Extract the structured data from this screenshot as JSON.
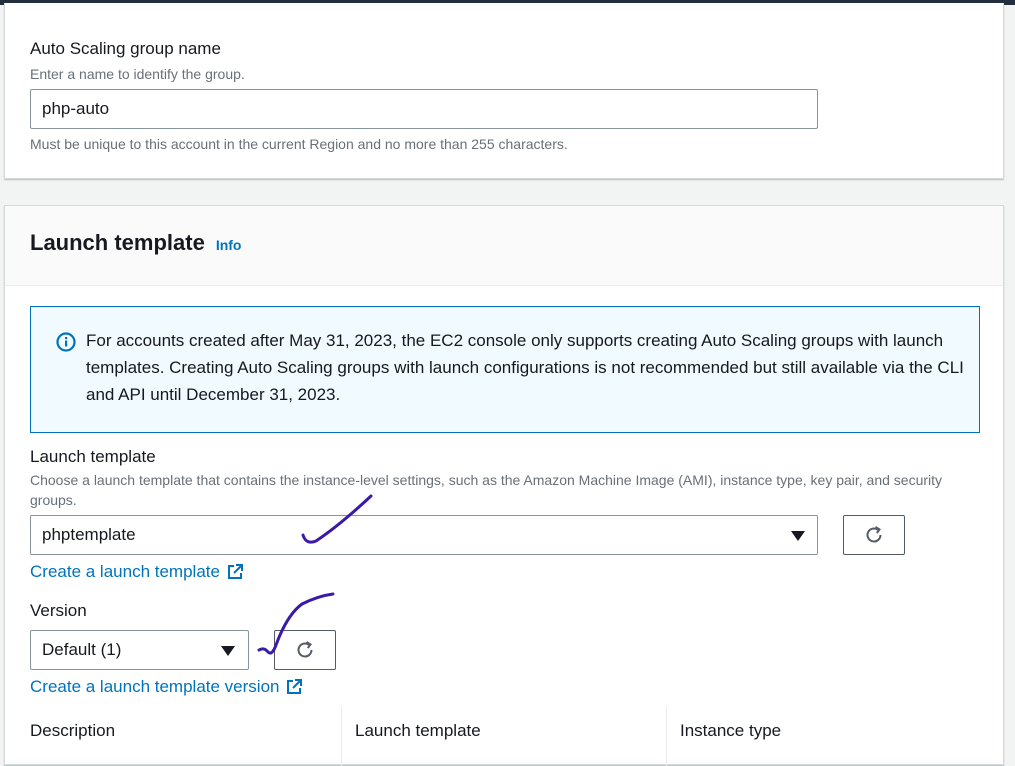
{
  "group_name": {
    "label": "Auto Scaling group name",
    "description": "Enter a name to identify the group.",
    "value": "php-auto",
    "constraint": "Must be unique to this account in the current Region and no more than 255 characters."
  },
  "launch_template_section": {
    "title": "Launch template",
    "info_link": "Info",
    "alert": {
      "icon": "info-circle-icon",
      "text": "For accounts created after May 31, 2023, the EC2 console only supports creating Auto Scaling groups with launch templates. Creating Auto Scaling groups with launch configurations is not recommended but still available via the CLI and API until December 31, 2023."
    },
    "template_field": {
      "label": "Launch template",
      "description": "Choose a launch template that contains the instance-level settings, such as the Amazon Machine Image (AMI), instance type, key pair, and security groups.",
      "selected": "phptemplate",
      "create_link": "Create a launch template"
    },
    "version_field": {
      "label": "Version",
      "selected": "Default (1)",
      "create_link": "Create a launch template version"
    },
    "summary_columns": [
      "Description",
      "Launch template",
      "Instance type"
    ]
  },
  "colors": {
    "link": "#0073bb",
    "alert_bg": "#f1faff",
    "alert_border": "#0073bb",
    "annotation": "#3a1aa8"
  }
}
